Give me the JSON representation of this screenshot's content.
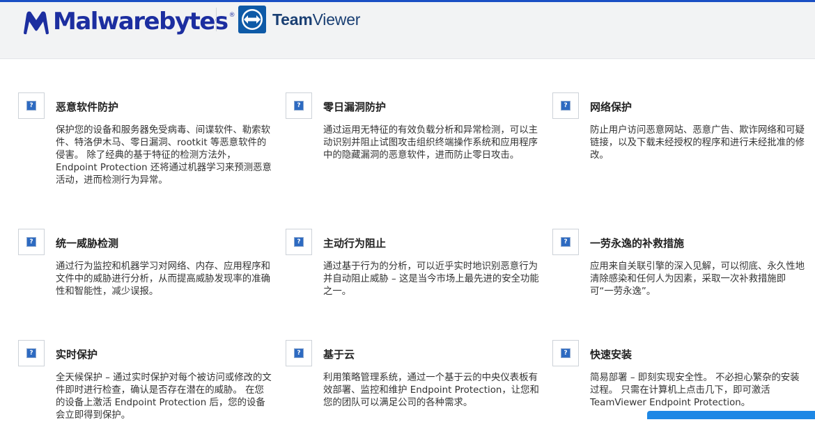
{
  "header": {
    "malwarebytes_logo": "Malwarebytes",
    "malwarebytes_reg": "®",
    "teamviewer_logo_bold": "Team",
    "teamviewer_logo_rest": "Viewer"
  },
  "features": [
    {
      "title": "恶意软件防护",
      "description": "保护您的设备和服务器免受病毒、间谍软件、勒索软件、特洛伊木马、零日漏洞、rootkit 等恶意软件的侵害。 除了经典的基于特征的检测方法外，Endpoint Protection 还将通过机器学习来预测恶意活动，进而检测行为异常。"
    },
    {
      "title": "零日漏洞防护",
      "description": "通过运用无特征的有效负载分析和异常检测，可以主动识别并阻止试图攻击组织终端操作系统和应用程序中的隐藏漏洞的恶意软件，进而防止零日攻击。"
    },
    {
      "title": "网络保护",
      "description": "防止用户访问恶意网站、恶意广告、欺诈网络和可疑链接，以及下载未经授权的程序和进行未经批准的修改。"
    },
    {
      "title": "统一威胁检测",
      "description": "通过行为监控和机器学习对网络、内存、应用程序和文件中的威胁进行分析，从而提高威胁发现率的准确性和智能性，减少误报。"
    },
    {
      "title": "主动行为阻止",
      "description": "通过基于行为的分析，可以近乎实时地识别恶意行为并自动阻止威胁 – 这是当今市场上最先进的安全功能之一。"
    },
    {
      "title": "一劳永逸的补救措施",
      "description": "应用来自关联引擎的深入见解，可以彻底、永久性地清除感染和任何人为因素，采取一次补救措施即可“一劳永逸”。"
    },
    {
      "title": "实时保护",
      "description": "全天候保护 – 通过实时保护对每个被访问或修改的文件即时进行检查，确认是否存在潜在的威胁。 在您的设备上激活 Endpoint Protection 后，您的设备会立即得到保护。"
    },
    {
      "title": "基于云",
      "description": "利用策略管理系统，通过一个基于云的中央仪表板有效部署、监控和维护 Endpoint Protection，让您和您的团队可以满足公司的各种需求。"
    },
    {
      "title": "快速安装",
      "description": "简易部署 – 即刻实现安全性。 不必担心繁杂的安装过程。 只需在计算机上点击几下，即可激活 TeamViewer Endpoint Protection。"
    }
  ],
  "icons": {
    "feature_icon": "broken-image-placeholder-icon",
    "placeholder_glyph": "?"
  },
  "colors": {
    "malwarebytes_blue": "#1c2ea0",
    "teamviewer_blue": "#0e5aa7",
    "header_bg": "#f2f3f4",
    "accent_bar": "#1a4fc4"
  }
}
